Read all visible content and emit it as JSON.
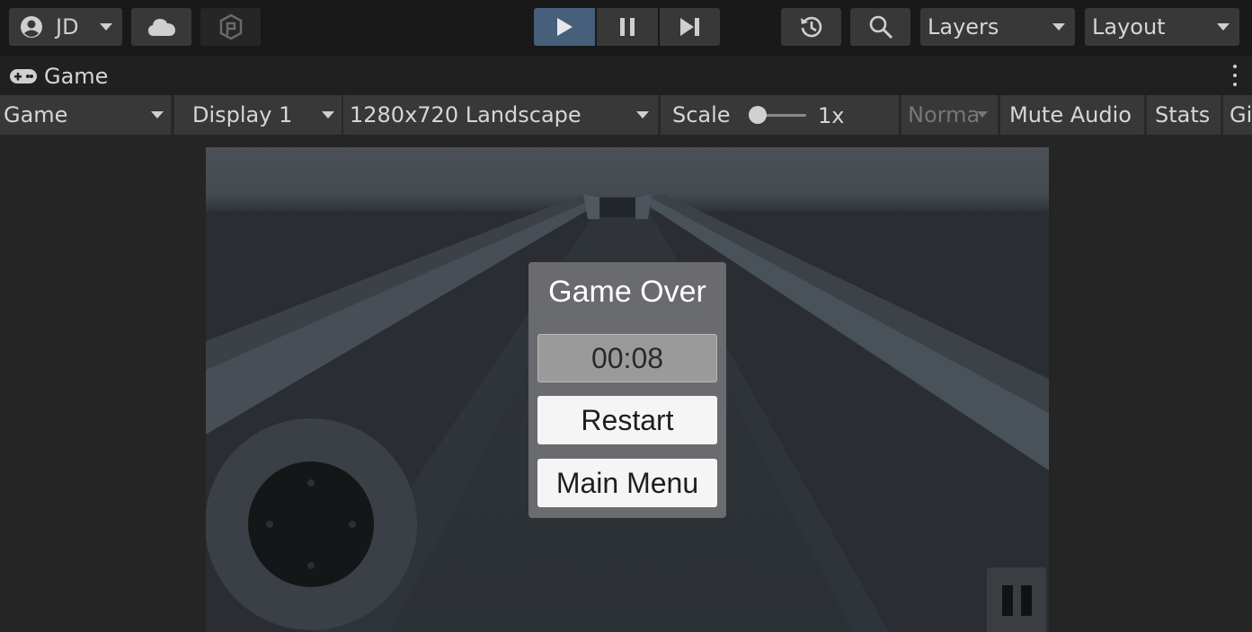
{
  "toolbar": {
    "account_label": "JD",
    "layers_label": "Layers",
    "layout_label": "Layout",
    "icons": [
      "account-icon",
      "cloud-icon",
      "package-icon",
      "play-icon",
      "pause-icon",
      "step-icon",
      "history-icon",
      "search-icon"
    ]
  },
  "tab": {
    "label": "Game",
    "icon": "gamepad-icon"
  },
  "game_toolbar": {
    "view_mode": "Game",
    "display": "Display 1",
    "resolution": "1280x720 Landscape",
    "scale_label": "Scale",
    "scale_value": "1x",
    "vsync_mode": "Norma",
    "mute_audio": "Mute Audio",
    "stats": "Stats",
    "gizmos": "Gi"
  },
  "game": {
    "panel_title": "Game Over",
    "timer": "00:08",
    "restart_label": "Restart",
    "main_menu_label": "Main Menu"
  },
  "colors": {
    "active_play": "#46607c",
    "toolbar_bg": "#191919",
    "button_bg": "#383838",
    "panel_bg": "#707074"
  }
}
